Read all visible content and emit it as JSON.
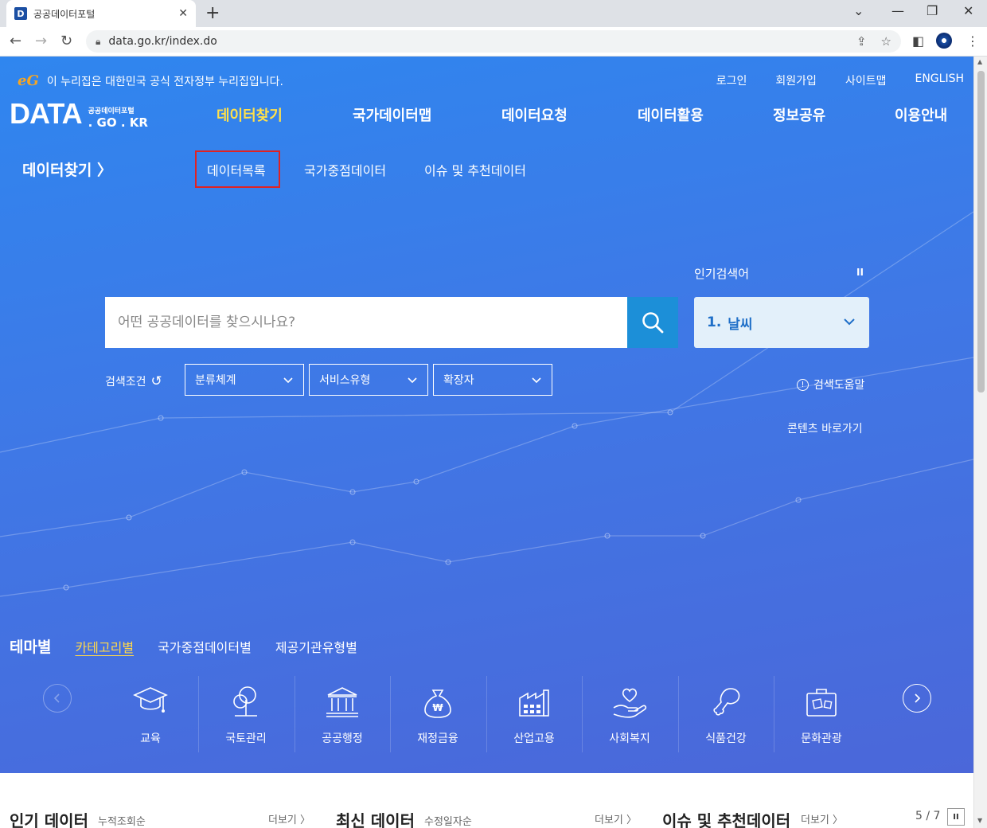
{
  "browser": {
    "tab_title": "공공데이터포털",
    "tab_favicon": "D",
    "new_tab": "+",
    "url": "data.go.kr/index.do"
  },
  "header": {
    "gov_notice": "이 누리집은 대한민국 공식 전자정부 누리집입니다.",
    "eg_logo": "eG",
    "top_links": [
      "로그인",
      "회원가입",
      "사이트맵",
      "ENGLISH"
    ],
    "logo_main": "DATA",
    "logo_sub1": "공공데이터포털",
    "logo_sub2": ". GO . KR"
  },
  "gnb": {
    "items": [
      "데이터찾기",
      "국가데이터맵",
      "데이터요청",
      "데이터활용",
      "정보공유",
      "이용안내"
    ]
  },
  "lnb": {
    "title": "데이터찾기",
    "items": [
      "데이터목록",
      "국가중점데이터",
      "이슈 및 추천데이터"
    ]
  },
  "search": {
    "placeholder": "어떤 공공데이터를 찾으시나요?",
    "popular_label": "인기검색어",
    "popular_pause": "II",
    "popular_rank": "1.",
    "popular_term": "날씨",
    "condition_label": "검색조건",
    "filters": [
      "분류체계",
      "서비스유형",
      "확장자"
    ],
    "help": "검색도움말",
    "help_icon": "!",
    "shortcut": "콘텐츠 바로가기"
  },
  "theme": {
    "title": "테마별",
    "tabs": [
      "카테고리별",
      "국가중점데이터별",
      "제공기관유형별"
    ],
    "categories": [
      "교육",
      "국토관리",
      "공공행정",
      "재정금융",
      "산업고용",
      "사회복지",
      "식품건강",
      "문화관광"
    ]
  },
  "bottom": {
    "popular_title": "인기 데이터",
    "popular_sub": "누적조회순",
    "latest_title": "최신 데이터",
    "latest_sub": "수정일자순",
    "issue_title": "이슈 및 추천데이터",
    "more": "더보기 〉",
    "pager": "5 / 7",
    "pager_pause": "II"
  },
  "colors": {
    "accent_yellow": "#ffe04b",
    "search_button": "#1c8fd8",
    "highlight_box": "#e02222"
  }
}
